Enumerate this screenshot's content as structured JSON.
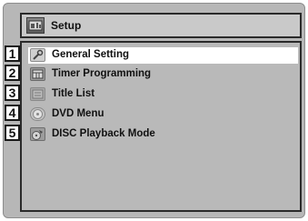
{
  "header": {
    "title": "Setup",
    "icon": "setup-icon"
  },
  "menu": {
    "items": [
      {
        "number": "1",
        "label": "General Setting",
        "icon": "wrench-icon",
        "selected": true
      },
      {
        "number": "2",
        "label": "Timer Programming",
        "icon": "timer-icon",
        "selected": false
      },
      {
        "number": "3",
        "label": "Title List",
        "icon": "title-list-icon",
        "selected": false
      },
      {
        "number": "4",
        "label": "DVD Menu",
        "icon": "dvd-icon",
        "selected": false
      },
      {
        "number": "5",
        "label": "DISC Playback Mode",
        "icon": "disc-icon",
        "selected": false
      }
    ]
  },
  "colors": {
    "background": "#b7b7b7",
    "selected": "#ffffff",
    "border": "#2a2a2a"
  }
}
